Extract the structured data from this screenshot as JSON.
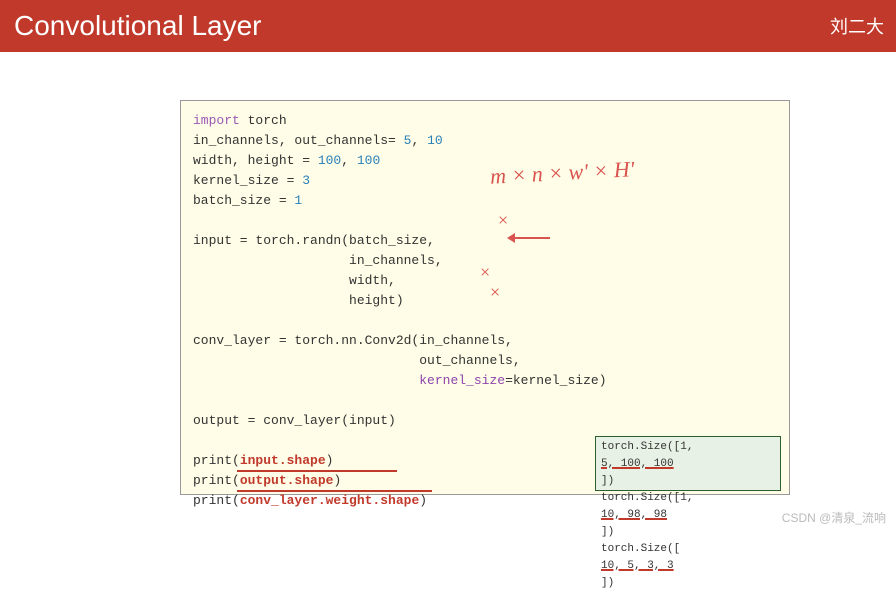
{
  "header": {
    "title": "Convolutional Layer",
    "author": "刘二大"
  },
  "code": {
    "line1": "import",
    "line1_b": " torch",
    "line2_a": "in_channels, out_channels= ",
    "line2_n1": "5",
    "line2_comma": ", ",
    "line2_n2": "10",
    "line3_a": "width, height = ",
    "line3_n1": "100",
    "line3_comma": ", ",
    "line3_n2": "100",
    "line4_a": "kernel_size = ",
    "line4_n": "3",
    "line5_a": "batch_size = ",
    "line5_n": "1",
    "line7": "input = torch.randn(batch_size,",
    "line8": "                    in_channels,",
    "line9": "                    width,",
    "line10": "                    height)",
    "line12_a": "conv_layer = torch.nn.Conv2d(in_channels,",
    "line13": "                             out_channels,",
    "line14_a": "                             ",
    "line14_kw": "kernel_size",
    "line14_b": "=kernel_size)",
    "line16": "output = conv_layer(input)",
    "p1a": "print(",
    "p1b": "input.shape",
    "p1c": ")",
    "p2a": "print(",
    "p2b": "output.shape",
    "p2c": ")",
    "p3a": "print(",
    "p3b": "conv_layer.weight.shape",
    "p3c": ")"
  },
  "output": {
    "row1_a": "torch.Size([1, ",
    "row1_b": "5,  100,  100",
    "row1_c": "])",
    "row2_a": "torch.Size([1, ",
    "row2_b": "10,  98,  98",
    "row2_c": "])",
    "row3_a": "torch.Size([",
    "row3_b": "10,  5,  3,  3",
    "row3_c": "])"
  },
  "annotation": "m × n × w' × H'",
  "marks": {
    "x": "×",
    "check": "×"
  },
  "watermark": "CSDN @清泉_流响"
}
